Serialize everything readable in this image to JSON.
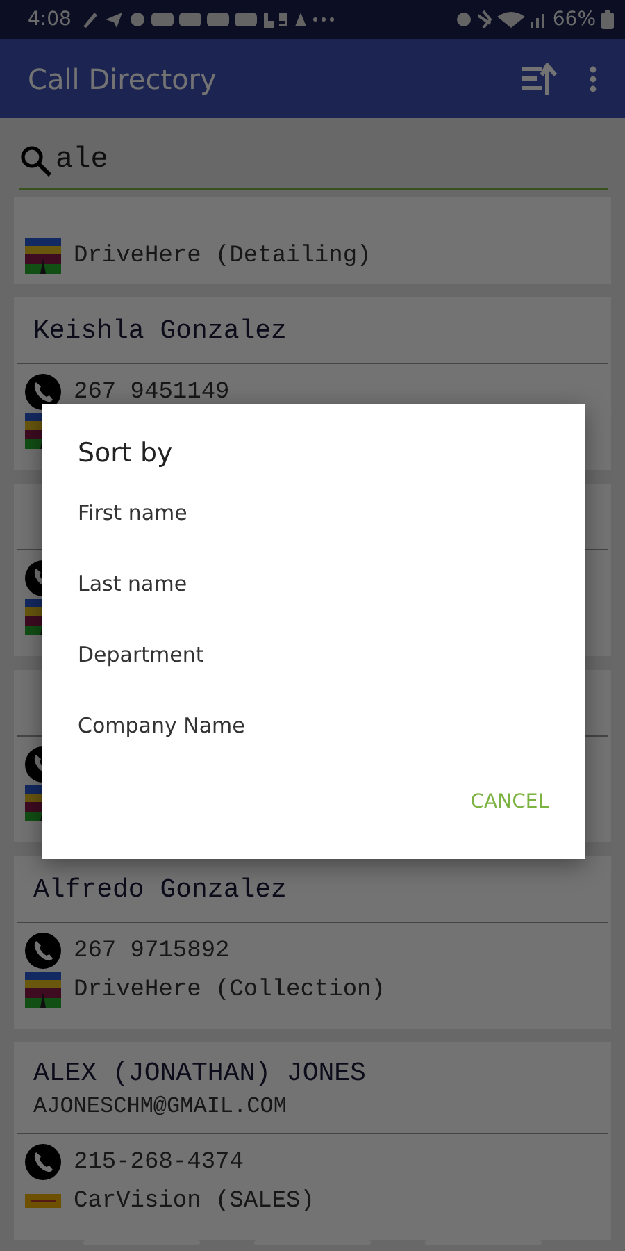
{
  "status_bar": {
    "time": "4:08",
    "battery": "66%"
  },
  "app_bar": {
    "title": "Call Directory"
  },
  "search": {
    "value": "ale"
  },
  "contacts": [
    {
      "kind": "partial",
      "rows": [
        {
          "kind": "drivehere",
          "text": "DriveHere (Detailing)"
        }
      ]
    },
    {
      "kind": "full",
      "name": "Keishla Gonzalez",
      "rows": [
        {
          "kind": "phone",
          "text": "267 9451149"
        },
        {
          "kind": "drivehere"
        }
      ]
    },
    {
      "kind": "full",
      "rows": [
        {
          "kind": "phone"
        },
        {
          "kind": "drivehere"
        }
      ]
    },
    {
      "kind": "full",
      "rows": [
        {
          "kind": "phone"
        },
        {
          "kind": "drivehere"
        }
      ]
    },
    {
      "kind": "full",
      "name": "Alfredo Gonzalez",
      "rows": [
        {
          "kind": "phone",
          "text": "267 9715892"
        },
        {
          "kind": "drivehere",
          "text": "DriveHere (Collection)"
        }
      ]
    },
    {
      "kind": "full",
      "name": "ALEX (JONATHAN) JONES",
      "email": "AJONESCHM@GMAIL.COM",
      "rows": [
        {
          "kind": "phone",
          "text": "215-268-4374"
        },
        {
          "kind": "carvision",
          "text": "CarVision (SALES)"
        }
      ]
    }
  ],
  "dialog": {
    "title": "Sort by",
    "options": [
      "First name",
      "Last name",
      "Department",
      "Company Name"
    ],
    "cancel": "CANCEL"
  }
}
